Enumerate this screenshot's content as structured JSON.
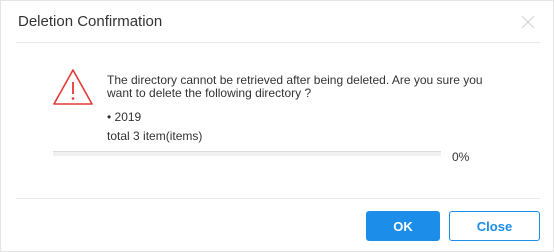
{
  "dialog": {
    "title": "Deletion Confirmation",
    "close_icon": "close-x-icon",
    "warning_icon": "warning-triangle-icon",
    "message": "The directory cannot be retrieved after being deleted. Are you sure you want to delete the following directory ?",
    "items": [
      "• 2019"
    ],
    "total": "total 3 item(items)",
    "progress": {
      "value_percent": 0,
      "label": "0%"
    },
    "buttons": {
      "ok": "OK",
      "close": "Close"
    }
  },
  "colors": {
    "accent": "#1c8eea",
    "warning": "#e53935",
    "text": "#333333"
  }
}
